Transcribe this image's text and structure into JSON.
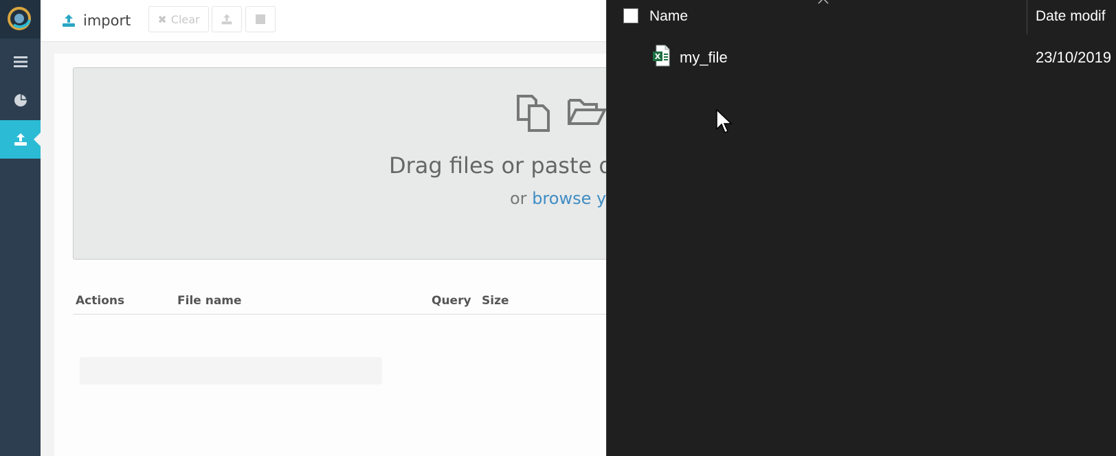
{
  "toolbar": {
    "title": "import",
    "clear_label": "Clear"
  },
  "dropzone": {
    "title": "Drag files or paste da",
    "sub_prefix": "or ",
    "sub_link": "browse yo"
  },
  "table": {
    "columns": [
      "Actions",
      "File name",
      "Query",
      "Size"
    ]
  },
  "dialog": {
    "columns": {
      "name": "Name",
      "date": "Date modif"
    },
    "files": [
      {
        "name": "my_file",
        "date": "23/10/2019",
        "icon": "excel-file-icon"
      }
    ]
  },
  "colors": {
    "nav_bg": "#2c3e50",
    "nav_active": "#2bbbd5",
    "link": "#3f8dc4",
    "dialog_bg": "#1f1f1f"
  }
}
